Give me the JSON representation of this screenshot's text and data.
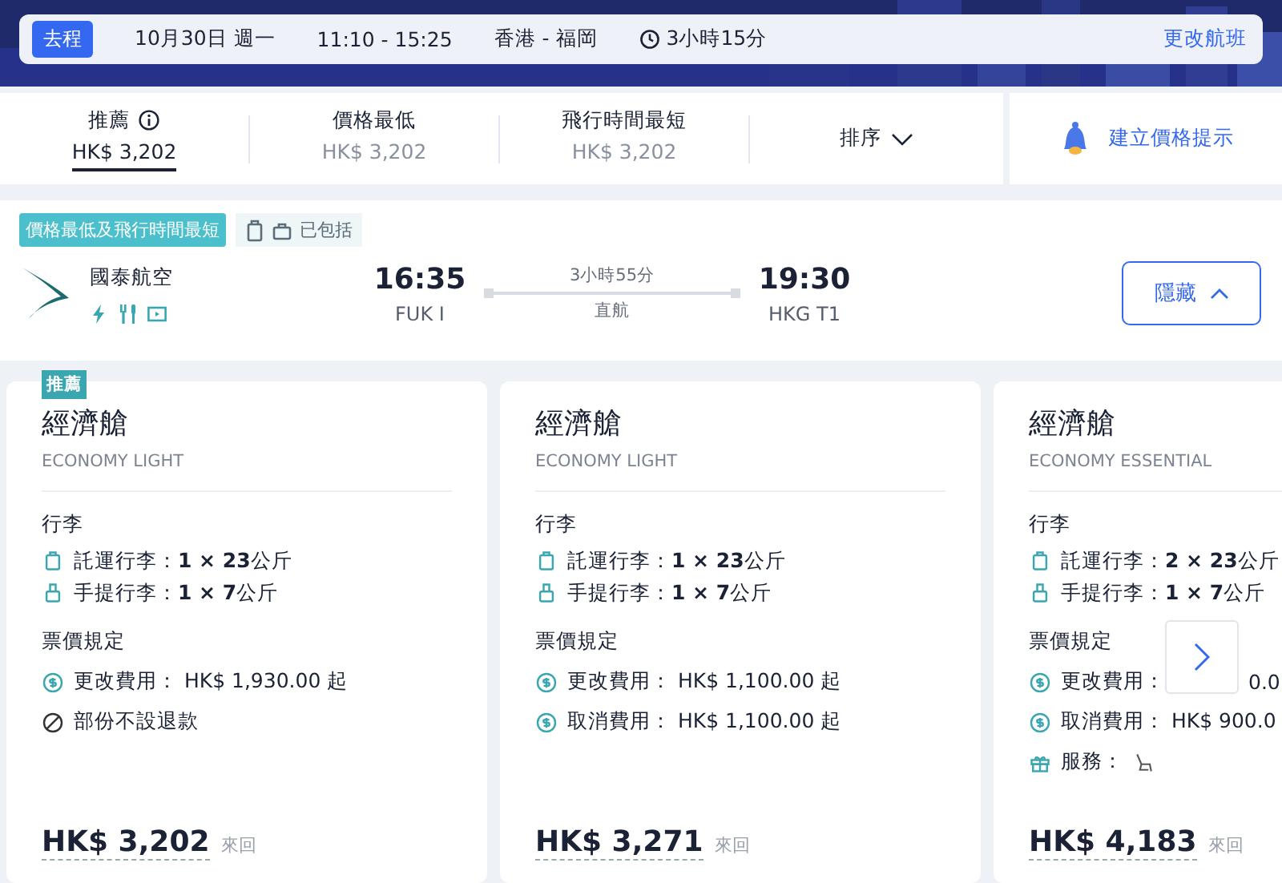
{
  "trip": {
    "tag": "去程",
    "date": "10月30日 週一",
    "time": "11:10 - 15:25",
    "route": "香港 - 福岡",
    "duration": "3小時15分",
    "change_link": "更改航班"
  },
  "sort_tabs": [
    {
      "label": "推薦",
      "price": "HK$ 3,202",
      "selected": true,
      "info": true
    },
    {
      "label": "價格最低",
      "price": "HK$ 3,202",
      "selected": false,
      "info": false
    },
    {
      "label": "飛行時間最短",
      "price": "HK$ 3,202",
      "selected": false,
      "info": false
    }
  ],
  "sort_menu": "排序",
  "price_alert": "建立價格提示",
  "flight": {
    "highlight_badge": "價格最低及飛行時間最短",
    "included": "已包括",
    "airline": "國泰航空",
    "departure": {
      "time": "16:35",
      "airport": "FUK I"
    },
    "duration": "3小時55分",
    "stops": "直航",
    "arrival": {
      "time": "19:30",
      "airport": "HKG T1"
    },
    "hide_button": "隱藏"
  },
  "fares": [
    {
      "ribbon": "推薦",
      "cabin": "經濟艙",
      "fare_name": "ECONOMY LIGHT",
      "baggage_title": "行李",
      "baggage": [
        {
          "kind": "checked",
          "text": "託運行李：**1 × 23**公斤"
        },
        {
          "kind": "carry",
          "text": "手提行李：**1 × 7**公斤"
        }
      ],
      "rules_title": "票價規定",
      "rules": [
        {
          "kind": "fee",
          "text": "更改費用： HK$ 1,930.00 起"
        },
        {
          "kind": "no-refund",
          "text": "部份不設退款"
        }
      ],
      "price": "HK$ 3,202",
      "trip_type": "來回"
    },
    {
      "cabin": "經濟艙",
      "fare_name": "ECONOMY LIGHT",
      "baggage_title": "行李",
      "baggage": [
        {
          "kind": "checked",
          "text": "託運行李：**1 × 23**公斤"
        },
        {
          "kind": "carry",
          "text": "手提行李：**1 × 7**公斤"
        }
      ],
      "rules_title": "票價規定",
      "rules": [
        {
          "kind": "fee",
          "text": "更改費用： HK$ 1,100.00 起"
        },
        {
          "kind": "fee",
          "text": "取消費用： HK$ 1,100.00 起"
        }
      ],
      "price": "HK$ 3,271",
      "trip_type": "來回"
    },
    {
      "cabin": "經濟艙",
      "fare_name": "ECONOMY ESSENTIAL",
      "baggage_title": "行李",
      "baggage": [
        {
          "kind": "checked",
          "text": "託運行李：**2 × 23**公斤"
        },
        {
          "kind": "carry",
          "text": "手提行李：**1 × 7**公斤"
        }
      ],
      "rules_title": "票價規定",
      "rules": [
        {
          "kind": "fee",
          "text": "更改費用：",
          "visible_tail": "0.0"
        },
        {
          "kind": "fee",
          "text": "取消費用： HK$ 900.0"
        },
        {
          "kind": "service",
          "text": "服務："
        }
      ],
      "price": "HK$ 4,183",
      "trip_type": "來回"
    }
  ]
}
